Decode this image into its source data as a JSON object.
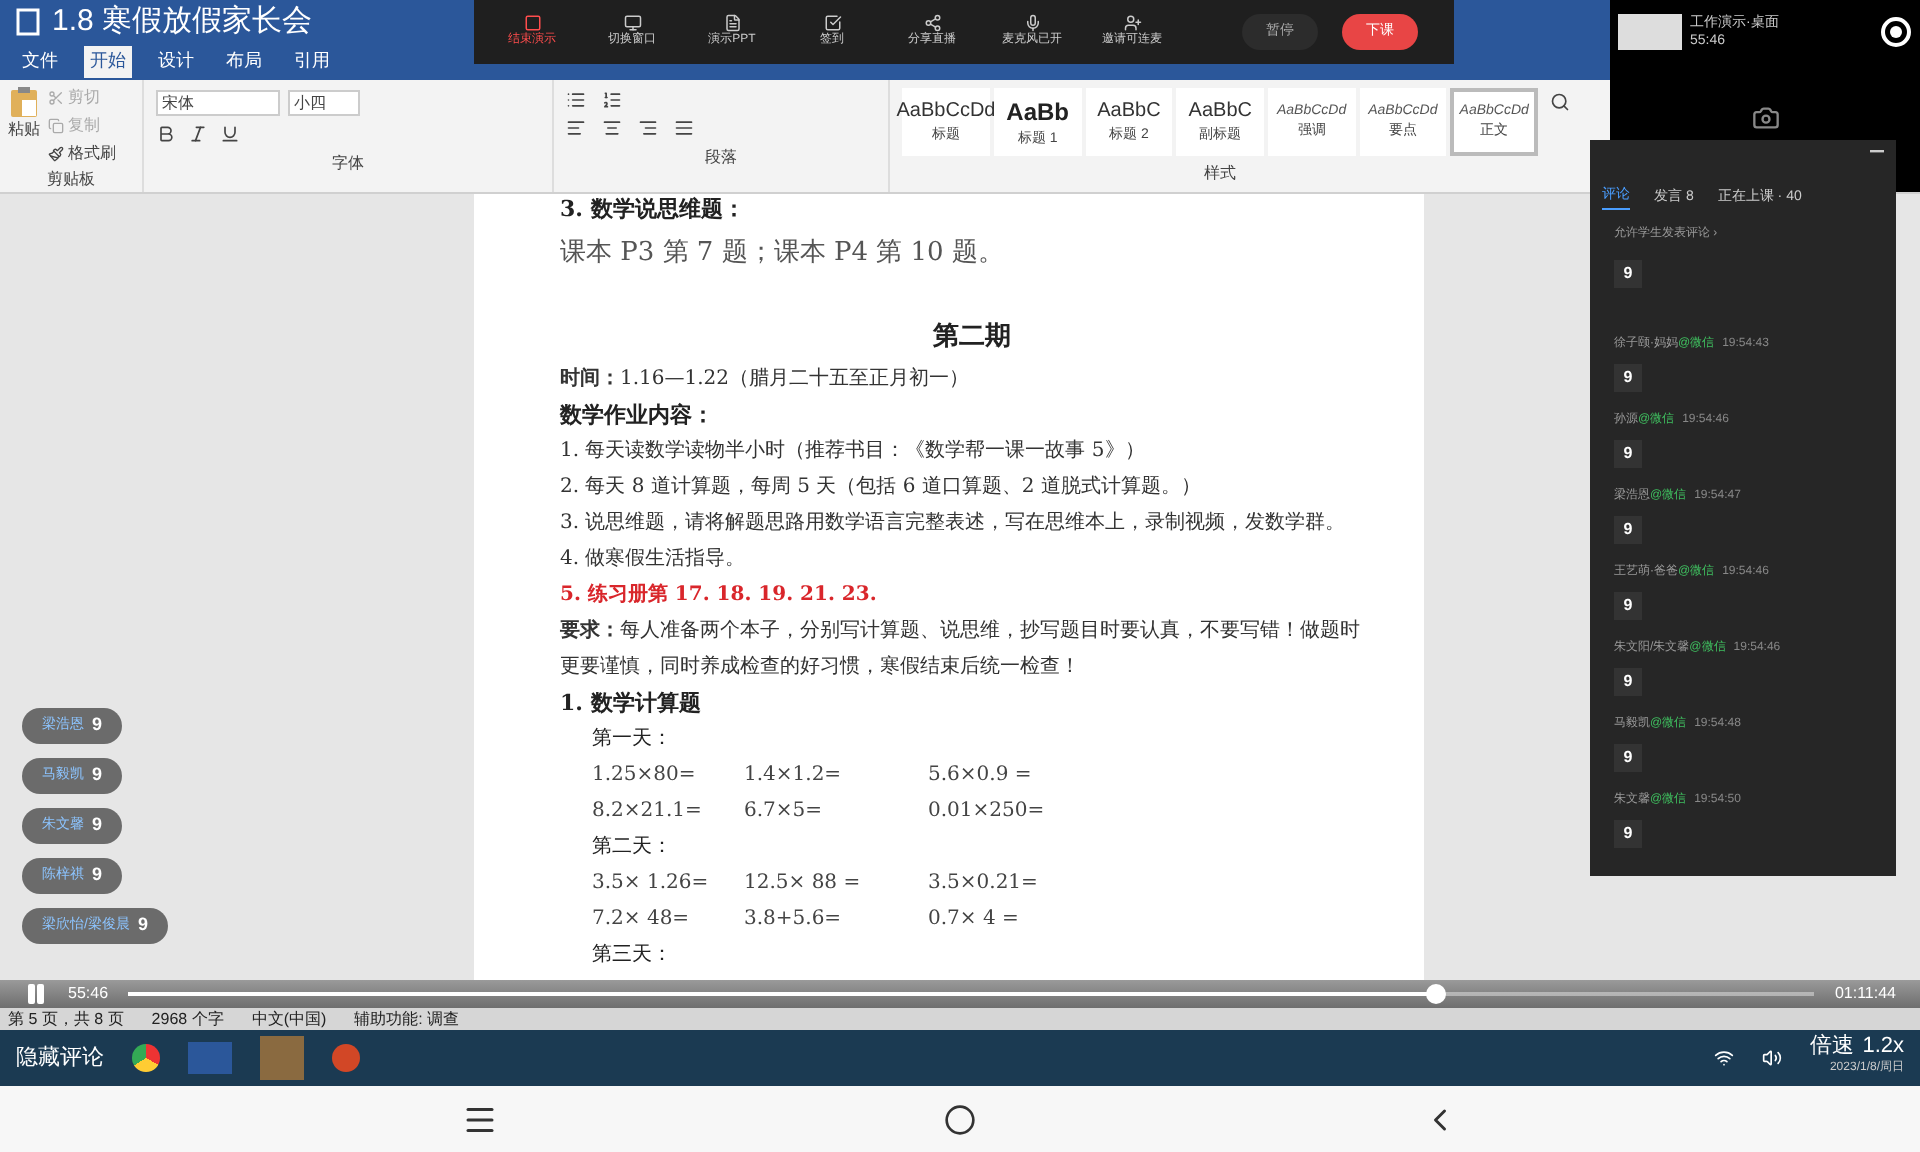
{
  "window": {
    "title": "1.8 寒假放假家长会"
  },
  "menu_tabs": [
    {
      "label": "文件",
      "selected": false
    },
    {
      "label": "开始",
      "selected": true
    },
    {
      "label": "设计",
      "selected": false
    },
    {
      "label": "布局",
      "selected": false
    },
    {
      "label": "引用",
      "selected": false
    }
  ],
  "live_toolbar": {
    "buttons": [
      {
        "label": "结束演示",
        "kind": "danger"
      },
      {
        "label": "切换窗口",
        "kind": "normal"
      },
      {
        "label": "演示PPT",
        "kind": "normal"
      },
      {
        "label": "签到",
        "kind": "normal"
      },
      {
        "label": "分享直播",
        "kind": "normal"
      },
      {
        "label": "麦克风已开",
        "kind": "normal"
      },
      {
        "label": "邀请可连麦",
        "kind": "normal"
      }
    ],
    "pause": "暂停",
    "end_class": "下课"
  },
  "preview": {
    "caption": "工作演示·桌面",
    "time": "55:46"
  },
  "ribbon": {
    "clipboard": {
      "paste": "粘贴",
      "cut": "剪切",
      "copy": "复制",
      "format_painter": "格式刷",
      "label": "剪贴板"
    },
    "font": {
      "family": "宋体",
      "size": "小四",
      "label": "字体"
    },
    "paragraph": {
      "label": "段落"
    },
    "styles": {
      "label": "样式",
      "items": [
        {
          "sample": "AaBbCcDd",
          "name": "标题",
          "selected": false
        },
        {
          "sample": "AaBb",
          "name": "标题 1",
          "selected": false
        },
        {
          "sample": "AaBbC",
          "name": "标题 2",
          "selected": false
        },
        {
          "sample": "AaBbC",
          "name": "副标题",
          "selected": false
        },
        {
          "sample": "AaBbCcDd",
          "name": "强调",
          "selected": false
        },
        {
          "sample": "AaBbCcDd",
          "name": "要点",
          "selected": false
        },
        {
          "sample": "AaBbCcDd",
          "name": "正文",
          "selected": true
        }
      ]
    }
  },
  "document": {
    "lines": [
      {
        "kind": "bold",
        "text": "3. 数学说思维题："
      },
      {
        "kind": "large",
        "text": "课本 P3 第 7 题；课本 P4 第 10 题。"
      },
      {
        "kind": "title",
        "text": "第二期"
      },
      {
        "kind": "text",
        "text": "**时间：**1.16—1.22（腊月二十五至正月初一）"
      },
      {
        "kind": "bold",
        "text": "数学作业内容："
      },
      {
        "kind": "text",
        "text": "1. 每天读数学读物半小时（推荐书目：《数学帮一课一故事 5》）"
      },
      {
        "kind": "text",
        "text": "2. 每天 8 道计算题，每周 5 天（包括 6 道口算题、2 道脱式计算题。）"
      },
      {
        "kind": "text",
        "text": "3. 说思维题，请将解题思路用数学语言完整表述，写在思维本上，录制视频，发数学群。"
      },
      {
        "kind": "text",
        "text": "4. 做寒假生活指导。"
      },
      {
        "kind": "red",
        "text": "5. 练习册第 17. 18. 19. 21. 23."
      },
      {
        "kind": "text",
        "text": "**要求：**每人准备两个本子，分别写计算题、说思维，抄写题目时要认真，不要写错！做题时"
      },
      {
        "kind": "text",
        "text": "更要谨慎，同时养成检查的好习惯，寒假结束后统一检查！"
      },
      {
        "kind": "bold",
        "text": "1. 数学计算题"
      },
      {
        "kind": "indent",
        "text": "第一天："
      },
      {
        "kind": "math",
        "cells": [
          "1.25×80=",
          "1.4×1.2=",
          "5.6×0.9 ="
        ]
      },
      {
        "kind": "math",
        "cells": [
          "8.2×21.1=",
          "6.7×5=",
          "0.01×250="
        ]
      },
      {
        "kind": "indent",
        "text": "第二天："
      },
      {
        "kind": "math",
        "cells": [
          "3.5× 1.26=",
          "12.5× 88 =",
          "3.5×0.21="
        ]
      },
      {
        "kind": "math",
        "cells": [
          "7.2× 48=",
          "3.8+5.6=",
          "0.7× 4 ="
        ]
      },
      {
        "kind": "indent",
        "text": "第三天："
      }
    ]
  },
  "comments_panel": {
    "tabs": [
      {
        "label": "评论",
        "selected": true
      },
      {
        "label": "发言 8",
        "selected": false
      },
      {
        "label": "正在上课 · 40",
        "selected": false
      }
    ],
    "allow": "允许学生发表评论 ›",
    "comments": [
      {
        "message": "9"
      },
      {
        "name": "徐子颐·妈妈",
        "source": "@微信",
        "time": "19:54:43",
        "message": "9"
      },
      {
        "name": "孙源",
        "source": "@微信",
        "time": "19:54:46",
        "message": "9"
      },
      {
        "name": "梁浩恩",
        "source": "@微信",
        "time": "19:54:47",
        "message": "9"
      },
      {
        "name": "王艺萌·爸爸",
        "source": "@微信",
        "time": "19:54:46",
        "message": "9"
      },
      {
        "name": "朱文阳/朱文馨",
        "source": "@微信",
        "time": "19:54:46",
        "message": "9"
      },
      {
        "name": "马毅凯",
        "source": "@微信",
        "time": "19:54:48",
        "message": "9"
      },
      {
        "name": "朱文馨",
        "source": "@微信",
        "time": "19:54:50",
        "message": "9"
      }
    ]
  },
  "floating_comments": [
    {
      "name": "梁浩恩",
      "message": "9"
    },
    {
      "name": "马毅凯",
      "message": "9"
    },
    {
      "name": "朱文馨",
      "message": "9"
    },
    {
      "name": "陈梓祺",
      "message": "9"
    },
    {
      "name": "梁欣怡/梁俊晨",
      "message": "9"
    }
  ],
  "player": {
    "elapsed": "55:46",
    "level": 0.775,
    "total": "01:11:44",
    "playing": true
  },
  "status_bar": {
    "page": "第 5 页，共 8 页",
    "words": "2968 个字",
    "language": "中文(中国)",
    "accessibility": "辅助功能: 调查"
  },
  "taskbar": {
    "hide_comments": "隐藏评论",
    "speed": "倍速",
    "speed_value": "1.2x",
    "date": "2023/1/8/周日"
  }
}
